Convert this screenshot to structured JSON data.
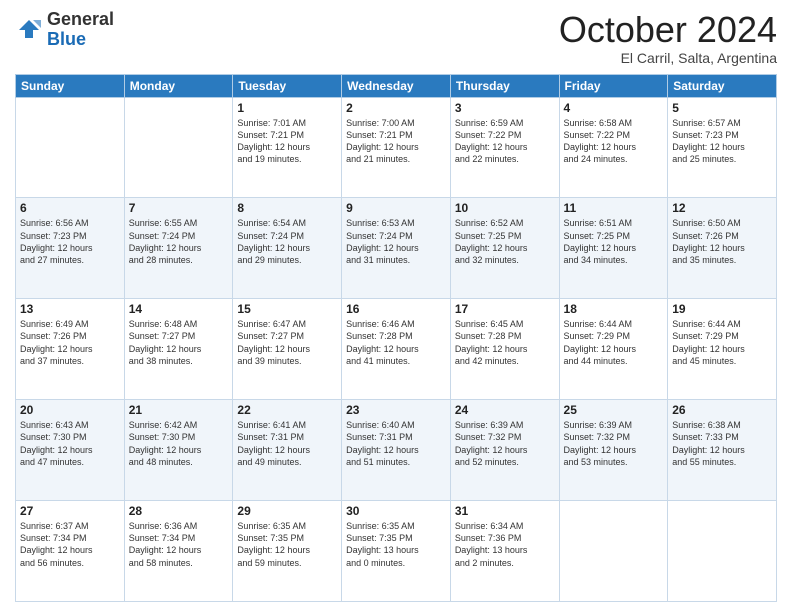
{
  "logo": {
    "general": "General",
    "blue": "Blue"
  },
  "header": {
    "month": "October 2024",
    "location": "El Carril, Salta, Argentina"
  },
  "days_of_week": [
    "Sunday",
    "Monday",
    "Tuesday",
    "Wednesday",
    "Thursday",
    "Friday",
    "Saturday"
  ],
  "weeks": [
    [
      {
        "day": "",
        "info": ""
      },
      {
        "day": "",
        "info": ""
      },
      {
        "day": "1",
        "info": "Sunrise: 7:01 AM\nSunset: 7:21 PM\nDaylight: 12 hours\nand 19 minutes."
      },
      {
        "day": "2",
        "info": "Sunrise: 7:00 AM\nSunset: 7:21 PM\nDaylight: 12 hours\nand 21 minutes."
      },
      {
        "day": "3",
        "info": "Sunrise: 6:59 AM\nSunset: 7:22 PM\nDaylight: 12 hours\nand 22 minutes."
      },
      {
        "day": "4",
        "info": "Sunrise: 6:58 AM\nSunset: 7:22 PM\nDaylight: 12 hours\nand 24 minutes."
      },
      {
        "day": "5",
        "info": "Sunrise: 6:57 AM\nSunset: 7:23 PM\nDaylight: 12 hours\nand 25 minutes."
      }
    ],
    [
      {
        "day": "6",
        "info": "Sunrise: 6:56 AM\nSunset: 7:23 PM\nDaylight: 12 hours\nand 27 minutes."
      },
      {
        "day": "7",
        "info": "Sunrise: 6:55 AM\nSunset: 7:24 PM\nDaylight: 12 hours\nand 28 minutes."
      },
      {
        "day": "8",
        "info": "Sunrise: 6:54 AM\nSunset: 7:24 PM\nDaylight: 12 hours\nand 29 minutes."
      },
      {
        "day": "9",
        "info": "Sunrise: 6:53 AM\nSunset: 7:24 PM\nDaylight: 12 hours\nand 31 minutes."
      },
      {
        "day": "10",
        "info": "Sunrise: 6:52 AM\nSunset: 7:25 PM\nDaylight: 12 hours\nand 32 minutes."
      },
      {
        "day": "11",
        "info": "Sunrise: 6:51 AM\nSunset: 7:25 PM\nDaylight: 12 hours\nand 34 minutes."
      },
      {
        "day": "12",
        "info": "Sunrise: 6:50 AM\nSunset: 7:26 PM\nDaylight: 12 hours\nand 35 minutes."
      }
    ],
    [
      {
        "day": "13",
        "info": "Sunrise: 6:49 AM\nSunset: 7:26 PM\nDaylight: 12 hours\nand 37 minutes."
      },
      {
        "day": "14",
        "info": "Sunrise: 6:48 AM\nSunset: 7:27 PM\nDaylight: 12 hours\nand 38 minutes."
      },
      {
        "day": "15",
        "info": "Sunrise: 6:47 AM\nSunset: 7:27 PM\nDaylight: 12 hours\nand 39 minutes."
      },
      {
        "day": "16",
        "info": "Sunrise: 6:46 AM\nSunset: 7:28 PM\nDaylight: 12 hours\nand 41 minutes."
      },
      {
        "day": "17",
        "info": "Sunrise: 6:45 AM\nSunset: 7:28 PM\nDaylight: 12 hours\nand 42 minutes."
      },
      {
        "day": "18",
        "info": "Sunrise: 6:44 AM\nSunset: 7:29 PM\nDaylight: 12 hours\nand 44 minutes."
      },
      {
        "day": "19",
        "info": "Sunrise: 6:44 AM\nSunset: 7:29 PM\nDaylight: 12 hours\nand 45 minutes."
      }
    ],
    [
      {
        "day": "20",
        "info": "Sunrise: 6:43 AM\nSunset: 7:30 PM\nDaylight: 12 hours\nand 47 minutes."
      },
      {
        "day": "21",
        "info": "Sunrise: 6:42 AM\nSunset: 7:30 PM\nDaylight: 12 hours\nand 48 minutes."
      },
      {
        "day": "22",
        "info": "Sunrise: 6:41 AM\nSunset: 7:31 PM\nDaylight: 12 hours\nand 49 minutes."
      },
      {
        "day": "23",
        "info": "Sunrise: 6:40 AM\nSunset: 7:31 PM\nDaylight: 12 hours\nand 51 minutes."
      },
      {
        "day": "24",
        "info": "Sunrise: 6:39 AM\nSunset: 7:32 PM\nDaylight: 12 hours\nand 52 minutes."
      },
      {
        "day": "25",
        "info": "Sunrise: 6:39 AM\nSunset: 7:32 PM\nDaylight: 12 hours\nand 53 minutes."
      },
      {
        "day": "26",
        "info": "Sunrise: 6:38 AM\nSunset: 7:33 PM\nDaylight: 12 hours\nand 55 minutes."
      }
    ],
    [
      {
        "day": "27",
        "info": "Sunrise: 6:37 AM\nSunset: 7:34 PM\nDaylight: 12 hours\nand 56 minutes."
      },
      {
        "day": "28",
        "info": "Sunrise: 6:36 AM\nSunset: 7:34 PM\nDaylight: 12 hours\nand 58 minutes."
      },
      {
        "day": "29",
        "info": "Sunrise: 6:35 AM\nSunset: 7:35 PM\nDaylight: 12 hours\nand 59 minutes."
      },
      {
        "day": "30",
        "info": "Sunrise: 6:35 AM\nSunset: 7:35 PM\nDaylight: 13 hours\nand 0 minutes."
      },
      {
        "day": "31",
        "info": "Sunrise: 6:34 AM\nSunset: 7:36 PM\nDaylight: 13 hours\nand 2 minutes."
      },
      {
        "day": "",
        "info": ""
      },
      {
        "day": "",
        "info": ""
      }
    ]
  ]
}
